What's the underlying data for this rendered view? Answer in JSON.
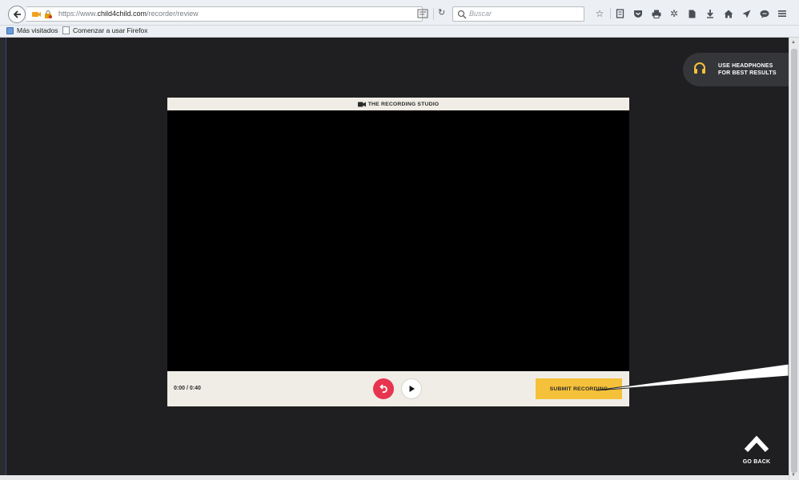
{
  "browser": {
    "url_prefix": "https://www.",
    "url_domain": "child4child.com",
    "url_path": "/recorder/review",
    "search_placeholder": "Buscar",
    "bookmarks": [
      "Más visitados",
      "Comenzar a usar Firefox"
    ]
  },
  "notice": {
    "line1": "USE HEADPHONES",
    "line2": "FOR BEST RESULTS",
    "icon": "headphones-icon",
    "icon_color": "#f5c13a"
  },
  "studio": {
    "title": "THE RECORDING STUDIO",
    "timecode": "0:00 / 0:40",
    "submit_label": "SUBMIT RECORDING",
    "colors": {
      "submit": "#f5c13a",
      "redo": "#e8344f",
      "panel": "#f0ede6"
    }
  },
  "nav": {
    "go_back_label": "GO BACK"
  }
}
